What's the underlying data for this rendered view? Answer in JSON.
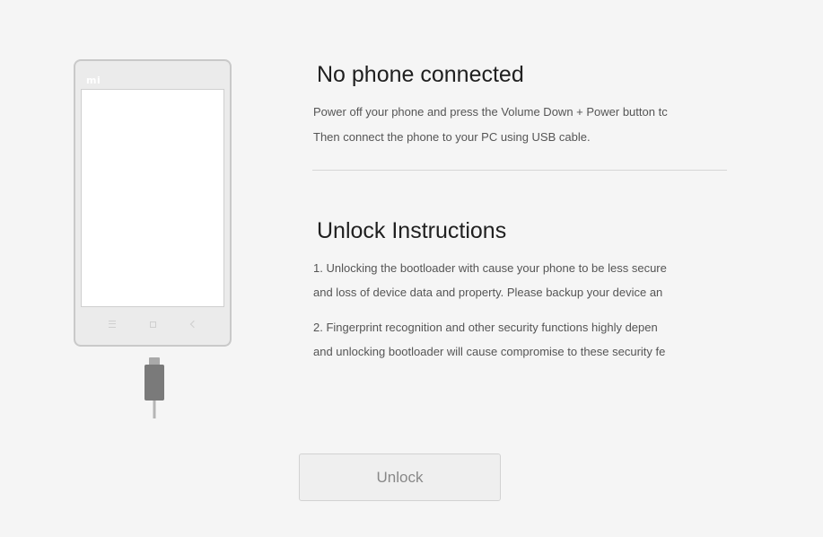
{
  "phone": {
    "logo": "mi"
  },
  "status": {
    "title": "No phone connected",
    "lines": [
      "Power off your phone and press the Volume Down + Power button tc",
      "Then connect the phone to your PC using USB cable."
    ]
  },
  "instructions": {
    "title": "Unlock Instructions",
    "lines": [
      "1. Unlocking the bootloader with cause your phone to be less secure",
      "and loss of device data and property. Please backup your device an",
      "2. Fingerprint recognition and other security functions highly depen",
      "and unlocking bootloader will cause compromise to these security fe"
    ]
  },
  "actions": {
    "unlock_label": "Unlock"
  },
  "icons": {
    "phone": "phone-illustration-icon",
    "usb": "usb-cable-icon",
    "menu": "menu-icon",
    "home": "home-icon",
    "back": "back-icon"
  },
  "colors": {
    "background": "#f5f5f5",
    "phone_frame": "#c9c9c9",
    "cable": "#777777",
    "button_bg": "#efefef",
    "button_text": "#888888"
  }
}
